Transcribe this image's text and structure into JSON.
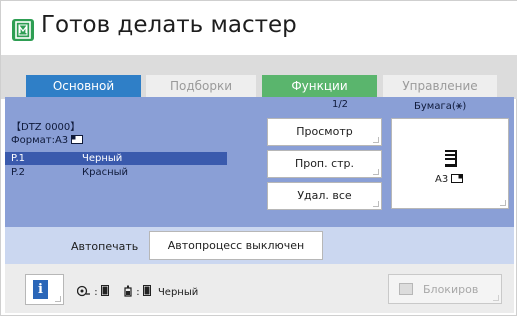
{
  "header": {
    "title": "Готов делать мастер",
    "icon": "master-icon",
    "accent_color": "#2e9e53"
  },
  "tabs": [
    {
      "label": "Основной",
      "active": true,
      "color": "#2f7fc7"
    },
    {
      "label": "Подборки",
      "active": false,
      "color": "#eeeeee"
    },
    {
      "label": "Функции",
      "active": false,
      "color": "#5ab56d"
    },
    {
      "label": "Управление",
      "active": false,
      "color": "#eeeeee"
    }
  ],
  "main": {
    "page_indicator": "1/2",
    "paper_label": "Бумага(",
    "paper_label_suffix": ")",
    "job_name": "【DTZ 0000】",
    "format_label": "Формат:A3",
    "rows": [
      {
        "p": "P.1",
        "color": "Черный",
        "selected": true
      },
      {
        "p": "P.2",
        "color": "Красный",
        "selected": false
      }
    ],
    "buttons": {
      "preview": "Просмотр",
      "skip_page": "Проп. стр.",
      "delete_all": "Удал. все"
    },
    "paper_size": "A3"
  },
  "autoprint": {
    "label": "Автопечать",
    "value": "Автопроцесс выключен"
  },
  "footer": {
    "info_icon": "i",
    "drum_color": "Черный",
    "lock_button": "Блокиров"
  }
}
